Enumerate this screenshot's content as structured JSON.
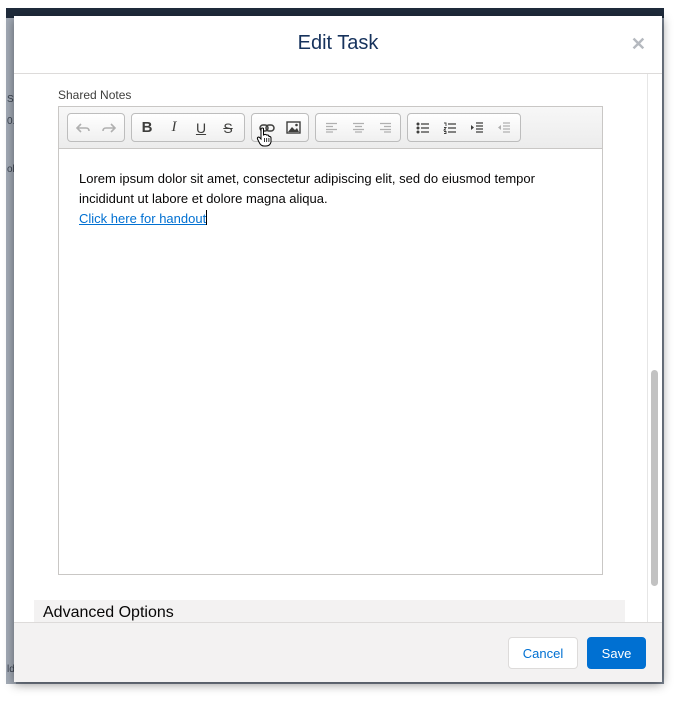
{
  "underlay": {
    "fragments": [
      "St",
      "0.",
      "ol",
      "ld"
    ]
  },
  "modal": {
    "title": "Edit Task",
    "close_icon": "close-icon"
  },
  "form": {
    "shared_notes_label": "Shared Notes"
  },
  "toolbar": {
    "groups": [
      [
        "undo-icon",
        "redo-icon"
      ],
      [
        "bold-icon",
        "italic-icon",
        "underline-icon",
        "strikethrough-icon"
      ],
      [
        "link-icon",
        "image-icon"
      ],
      [
        "align-left-icon",
        "align-center-icon",
        "align-right-icon"
      ],
      [
        "bulleted-list-icon",
        "numbered-list-icon",
        "indent-icon",
        "outdent-icon"
      ]
    ]
  },
  "editor": {
    "paragraph": "Lorem ipsum dolor sit amet, consectetur adipiscing elit, sed do eiusmod tempor incididunt ut labore et dolore magna aliqua.",
    "link_text": "Click here for handout"
  },
  "sections": {
    "advanced_options": "Advanced Options"
  },
  "footer": {
    "cancel_label": "Cancel",
    "save_label": "Save"
  },
  "colors": {
    "brand_blue": "#0070d2",
    "title_navy": "#16325c",
    "footer_bg": "#f3f2f2"
  }
}
